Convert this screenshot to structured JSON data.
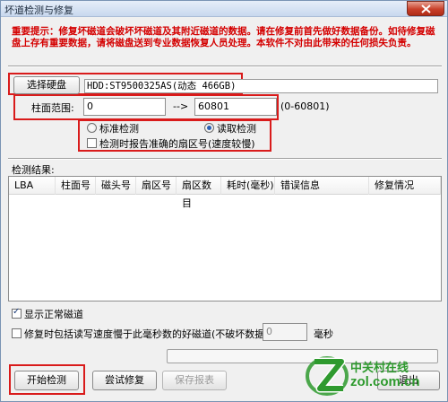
{
  "window": {
    "title": "坏道检测与修复"
  },
  "warning": {
    "text": "重要提示：修复坏磁道会破坏坏磁道及其附近磁道的数据。请在修复前首先做好数据备份。如待修复磁盘上存有重要数据，请将磁盘送到专业数据恢复人员处理。本软件不对由此带来的任何损失负责。"
  },
  "disk": {
    "select_button": "选择硬盘",
    "info": "HDD:ST9500325AS(动态 466GB)"
  },
  "cylinder": {
    "label": "柱面范围:",
    "start": "0",
    "arrow": "-->",
    "end": "60801",
    "range_hint": "(0-60801)"
  },
  "options": {
    "standard_label": "标准检测",
    "read_label": "读取检测",
    "selected_mode": "read",
    "report_label": "检测时报告准确的扇区号(速度较慢)",
    "report_checked": false
  },
  "results": {
    "label": "检测结果:",
    "columns": [
      "LBA",
      "柱面号",
      "磁头号",
      "扇区号",
      "扇区数目",
      "耗时(毫秒)",
      "错误信息",
      "修复情况"
    ],
    "rows": []
  },
  "show_normal": {
    "label": "显示正常磁道",
    "checked": true
  },
  "slow_repair": {
    "label": "修复时包括读写速度慢于此毫秒数的好磁道(不破坏数据):",
    "value": "0",
    "unit": "毫秒",
    "checked": false
  },
  "buttons": {
    "start": "开始检测",
    "try_repair": "尝试修复",
    "save_report": "保存报表",
    "exit": "退出"
  },
  "watermark": {
    "brand": "中关村在线",
    "domain": "zol.com.cn"
  },
  "colors": {
    "warning": "#d40000",
    "highlight": "#d91b1b",
    "title_bar": "#c8d8ee",
    "close_button": "#c8402a",
    "watermark": "#2e9a2e"
  }
}
